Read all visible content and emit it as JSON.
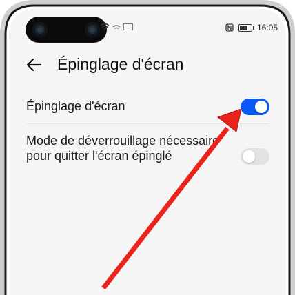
{
  "status_bar": {
    "time": "16:05",
    "battery_level": 0.7,
    "icons": [
      "wifi-icon",
      "signal-icon",
      "notification-icon",
      "nfc-icon",
      "battery-icon"
    ]
  },
  "header": {
    "back_icon": "arrow-left-icon",
    "title": "Épinglage d'écran"
  },
  "settings": [
    {
      "label": "Épinglage d'écran",
      "enabled": true
    },
    {
      "label": "Mode de déverrouillage nécessaire pour quitter l'écran épinglé",
      "enabled": false
    }
  ],
  "colors": {
    "toggle_on": "#0a59f7",
    "toggle_off": "#e2e2e2",
    "arrow": "#e8241c",
    "background": "#f5f5f5"
  }
}
